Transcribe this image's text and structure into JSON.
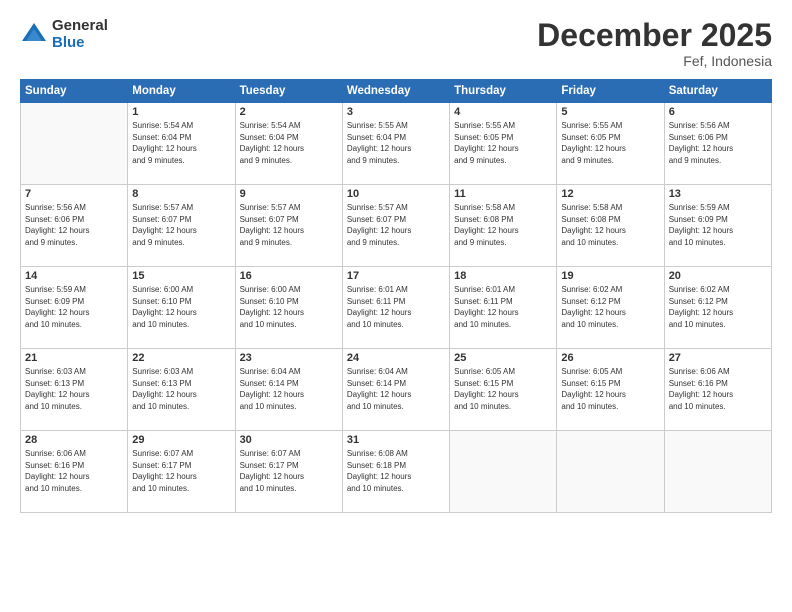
{
  "logo": {
    "general": "General",
    "blue": "Blue"
  },
  "title": "December 2025",
  "subtitle": "Fef, Indonesia",
  "days_header": [
    "Sunday",
    "Monday",
    "Tuesday",
    "Wednesday",
    "Thursday",
    "Friday",
    "Saturday"
  ],
  "weeks": [
    [
      {
        "day": "",
        "info": ""
      },
      {
        "day": "1",
        "info": "Sunrise: 5:54 AM\nSunset: 6:04 PM\nDaylight: 12 hours\nand 9 minutes."
      },
      {
        "day": "2",
        "info": "Sunrise: 5:54 AM\nSunset: 6:04 PM\nDaylight: 12 hours\nand 9 minutes."
      },
      {
        "day": "3",
        "info": "Sunrise: 5:55 AM\nSunset: 6:04 PM\nDaylight: 12 hours\nand 9 minutes."
      },
      {
        "day": "4",
        "info": "Sunrise: 5:55 AM\nSunset: 6:05 PM\nDaylight: 12 hours\nand 9 minutes."
      },
      {
        "day": "5",
        "info": "Sunrise: 5:55 AM\nSunset: 6:05 PM\nDaylight: 12 hours\nand 9 minutes."
      },
      {
        "day": "6",
        "info": "Sunrise: 5:56 AM\nSunset: 6:06 PM\nDaylight: 12 hours\nand 9 minutes."
      }
    ],
    [
      {
        "day": "7",
        "info": "Sunrise: 5:56 AM\nSunset: 6:06 PM\nDaylight: 12 hours\nand 9 minutes."
      },
      {
        "day": "8",
        "info": "Sunrise: 5:57 AM\nSunset: 6:07 PM\nDaylight: 12 hours\nand 9 minutes."
      },
      {
        "day": "9",
        "info": "Sunrise: 5:57 AM\nSunset: 6:07 PM\nDaylight: 12 hours\nand 9 minutes."
      },
      {
        "day": "10",
        "info": "Sunrise: 5:57 AM\nSunset: 6:07 PM\nDaylight: 12 hours\nand 9 minutes."
      },
      {
        "day": "11",
        "info": "Sunrise: 5:58 AM\nSunset: 6:08 PM\nDaylight: 12 hours\nand 9 minutes."
      },
      {
        "day": "12",
        "info": "Sunrise: 5:58 AM\nSunset: 6:08 PM\nDaylight: 12 hours\nand 10 minutes."
      },
      {
        "day": "13",
        "info": "Sunrise: 5:59 AM\nSunset: 6:09 PM\nDaylight: 12 hours\nand 10 minutes."
      }
    ],
    [
      {
        "day": "14",
        "info": "Sunrise: 5:59 AM\nSunset: 6:09 PM\nDaylight: 12 hours\nand 10 minutes."
      },
      {
        "day": "15",
        "info": "Sunrise: 6:00 AM\nSunset: 6:10 PM\nDaylight: 12 hours\nand 10 minutes."
      },
      {
        "day": "16",
        "info": "Sunrise: 6:00 AM\nSunset: 6:10 PM\nDaylight: 12 hours\nand 10 minutes."
      },
      {
        "day": "17",
        "info": "Sunrise: 6:01 AM\nSunset: 6:11 PM\nDaylight: 12 hours\nand 10 minutes."
      },
      {
        "day": "18",
        "info": "Sunrise: 6:01 AM\nSunset: 6:11 PM\nDaylight: 12 hours\nand 10 minutes."
      },
      {
        "day": "19",
        "info": "Sunrise: 6:02 AM\nSunset: 6:12 PM\nDaylight: 12 hours\nand 10 minutes."
      },
      {
        "day": "20",
        "info": "Sunrise: 6:02 AM\nSunset: 6:12 PM\nDaylight: 12 hours\nand 10 minutes."
      }
    ],
    [
      {
        "day": "21",
        "info": "Sunrise: 6:03 AM\nSunset: 6:13 PM\nDaylight: 12 hours\nand 10 minutes."
      },
      {
        "day": "22",
        "info": "Sunrise: 6:03 AM\nSunset: 6:13 PM\nDaylight: 12 hours\nand 10 minutes."
      },
      {
        "day": "23",
        "info": "Sunrise: 6:04 AM\nSunset: 6:14 PM\nDaylight: 12 hours\nand 10 minutes."
      },
      {
        "day": "24",
        "info": "Sunrise: 6:04 AM\nSunset: 6:14 PM\nDaylight: 12 hours\nand 10 minutes."
      },
      {
        "day": "25",
        "info": "Sunrise: 6:05 AM\nSunset: 6:15 PM\nDaylight: 12 hours\nand 10 minutes."
      },
      {
        "day": "26",
        "info": "Sunrise: 6:05 AM\nSunset: 6:15 PM\nDaylight: 12 hours\nand 10 minutes."
      },
      {
        "day": "27",
        "info": "Sunrise: 6:06 AM\nSunset: 6:16 PM\nDaylight: 12 hours\nand 10 minutes."
      }
    ],
    [
      {
        "day": "28",
        "info": "Sunrise: 6:06 AM\nSunset: 6:16 PM\nDaylight: 12 hours\nand 10 minutes."
      },
      {
        "day": "29",
        "info": "Sunrise: 6:07 AM\nSunset: 6:17 PM\nDaylight: 12 hours\nand 10 minutes."
      },
      {
        "day": "30",
        "info": "Sunrise: 6:07 AM\nSunset: 6:17 PM\nDaylight: 12 hours\nand 10 minutes."
      },
      {
        "day": "31",
        "info": "Sunrise: 6:08 AM\nSunset: 6:18 PM\nDaylight: 12 hours\nand 10 minutes."
      },
      {
        "day": "",
        "info": ""
      },
      {
        "day": "",
        "info": ""
      },
      {
        "day": "",
        "info": ""
      }
    ]
  ]
}
